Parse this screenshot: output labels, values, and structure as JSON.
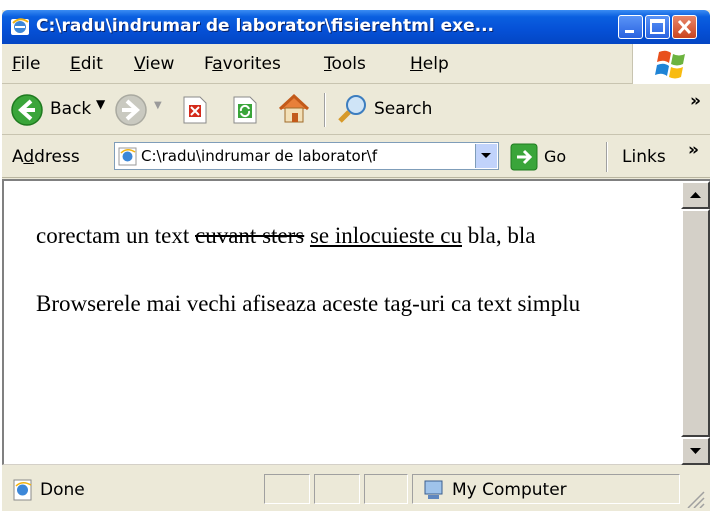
{
  "window": {
    "title": "C:\\radu\\indrumar de laborator\\fisierehtml exe..."
  },
  "menu": {
    "items": [
      {
        "accel": "F",
        "rest": "ile"
      },
      {
        "accel": "E",
        "rest": "dit"
      },
      {
        "accel": "V",
        "rest": "iew"
      },
      {
        "pre": "F",
        "accel": "a",
        "rest": "vorites"
      },
      {
        "accel": "T",
        "rest": "ools"
      },
      {
        "accel": "H",
        "rest": "elp"
      }
    ]
  },
  "toolbar": {
    "back_label": "Back",
    "search_label": "Search",
    "chevron": "»"
  },
  "address": {
    "label_pre": "A",
    "label_accel": "d",
    "label_rest": "dress",
    "value": "C:\\radu\\indrumar de laborator\\f",
    "go_label": "Go",
    "links_label": "Links",
    "links_chevron": "»"
  },
  "content": {
    "p1_plain_start": "corectam un text ",
    "p1_deleted": "cuvant sters",
    "p1_space": " ",
    "p1_inserted": "se inlocuieste cu",
    "p1_plain_end": " bla, bla",
    "p2": "Browserele mai vechi afiseaza aceste tag-uri ca text simplu"
  },
  "status": {
    "left_text": "Done",
    "zone_text": "My Computer"
  },
  "colors": {
    "titlebar": "#0550d6",
    "chrome": "#ece9d8",
    "back_green": "#3aa53a",
    "stop_red": "#d42a1a"
  }
}
